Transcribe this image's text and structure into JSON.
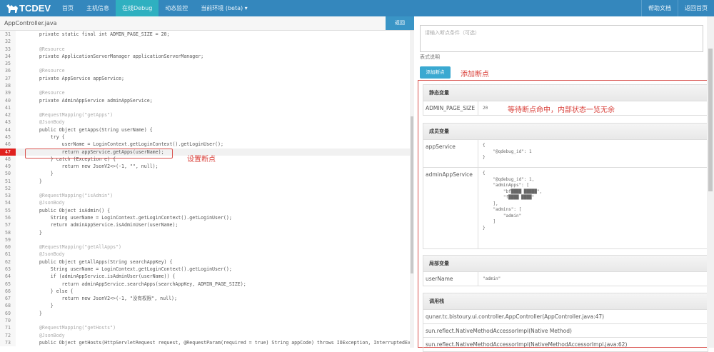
{
  "nav": {
    "brand": "TCDEV",
    "items": [
      "首页",
      "主机信息",
      "在线Debug",
      "动态监控",
      "当前环境 (beta) ▾"
    ],
    "active": 2,
    "right": [
      "帮助文档",
      "返回首页"
    ]
  },
  "editor": {
    "filename": "AppController.java",
    "back_label": "返回",
    "breakpoint_line": 47,
    "lines": [
      {
        "n": 31,
        "t": "    private static final int ADMIN_PAGE_SIZE = 20;"
      },
      {
        "n": 32,
        "t": ""
      },
      {
        "n": 33,
        "t": "    @Resource",
        "c": "ann"
      },
      {
        "n": 34,
        "t": "    private ApplicationServerManager applicationServerManager;"
      },
      {
        "n": 35,
        "t": ""
      },
      {
        "n": 36,
        "t": "    @Resource",
        "c": "ann"
      },
      {
        "n": 37,
        "t": "    private AppService appService;"
      },
      {
        "n": 38,
        "t": ""
      },
      {
        "n": 39,
        "t": "    @Resource",
        "c": "ann"
      },
      {
        "n": 40,
        "t": "    private AdminAppService adminAppService;"
      },
      {
        "n": 41,
        "t": ""
      },
      {
        "n": 42,
        "t": "    @RequestMapping(\"getApps\")",
        "c": "ann"
      },
      {
        "n": 43,
        "t": "    @JsonBody",
        "c": "ann"
      },
      {
        "n": 44,
        "t": "    public Object getApps(String userName) {"
      },
      {
        "n": 45,
        "t": "        try {"
      },
      {
        "n": 46,
        "t": "            userName = LoginContext.getLoginContext().getLoginUser();"
      },
      {
        "n": 47,
        "t": "            return appService.getApps(userName);"
      },
      {
        "n": 48,
        "t": "        } catch (Exception e) {"
      },
      {
        "n": 49,
        "t": "            return new JsonV2<>(-1, \"\", null);"
      },
      {
        "n": 50,
        "t": "        }"
      },
      {
        "n": 51,
        "t": "    }"
      },
      {
        "n": 52,
        "t": ""
      },
      {
        "n": 53,
        "t": "    @RequestMapping(\"isAdmin\")",
        "c": "ann"
      },
      {
        "n": 54,
        "t": "    @JsonBody",
        "c": "ann"
      },
      {
        "n": 55,
        "t": "    public Object isAdmin() {"
      },
      {
        "n": 56,
        "t": "        String userName = LoginContext.getLoginContext().getLoginUser();"
      },
      {
        "n": 57,
        "t": "        return adminAppService.isAdminUser(userName);"
      },
      {
        "n": 58,
        "t": "    }"
      },
      {
        "n": 59,
        "t": ""
      },
      {
        "n": 60,
        "t": "    @RequestMapping(\"getAllApps\")",
        "c": "ann"
      },
      {
        "n": 61,
        "t": "    @JsonBody",
        "c": "ann"
      },
      {
        "n": 62,
        "t": "    public Object getAllApps(String searchAppKey) {"
      },
      {
        "n": 63,
        "t": "        String userName = LoginContext.getLoginContext().getLoginUser();"
      },
      {
        "n": 64,
        "t": "        if (adminAppService.isAdminUser(userName)) {"
      },
      {
        "n": 65,
        "t": "            return adminAppService.searchApps(searchAppKey, ADMIN_PAGE_SIZE);"
      },
      {
        "n": 66,
        "t": "        } else {"
      },
      {
        "n": 67,
        "t": "            return new JsonV2<>(-1, \"没有权限\", null);"
      },
      {
        "n": 68,
        "t": "        }"
      },
      {
        "n": 69,
        "t": "    }"
      },
      {
        "n": 70,
        "t": ""
      },
      {
        "n": 71,
        "t": "    @RequestMapping(\"getHosts\")",
        "c": "ann"
      },
      {
        "n": 72,
        "t": "    @JsonBody",
        "c": "ann"
      },
      {
        "n": 73,
        "t": "    public Object getHosts(HttpServletRequest request, @RequestParam(required = true) String appCode) throws IOException, InterruptedEx"
      }
    ]
  },
  "annotations": {
    "set_breakpoint": "设置断点",
    "add_breakpoint": "添加断点",
    "state_note": "等待断点命中，内部状态一览无余"
  },
  "panel": {
    "condition_placeholder": "请输入断点条件（可选）",
    "expr_help": "表式说明",
    "add_button": "添加断点",
    "static": {
      "title": "静态变量",
      "rows": [
        {
          "k": "ADMIN_PAGE_SIZE",
          "v": "20"
        }
      ]
    },
    "member": {
      "title": "成员变量",
      "rows": [
        {
          "k": "appService",
          "v": "{\n    \"@qdebug_id\": 1\n}"
        },
        {
          "k": "adminAppService",
          "v": "{\n    \"@qdebug_id\": 1,\n    \"adminApps\": [\n        \"bf████ █████\",\n        \"f████ ████\"\n    ],\n    \"admins\": [\n        \"admin\"\n    ]\n}"
        }
      ]
    },
    "local": {
      "title": "局部变量",
      "rows": [
        {
          "k": "userName",
          "v": "\"admin\""
        }
      ]
    },
    "stack": {
      "title": "调用栈",
      "rows": [
        "qunar.tc.bistoury.ui.controller.AppController(AppController.java:47)",
        "sun.reflect.NativeMethodAccessorImpl(Native Method)",
        "sun.reflect.NativeMethodAccessorImpl(NativeMethodAccessorImpl.java:62)"
      ]
    }
  }
}
